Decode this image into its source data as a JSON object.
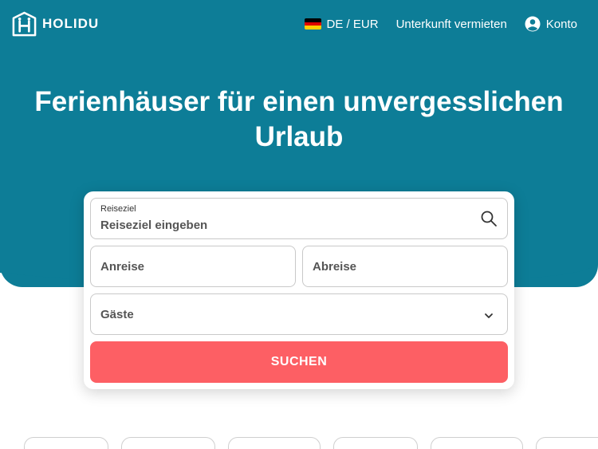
{
  "brand": {
    "name": "HOLIDU",
    "primary_color": "#0d7d97",
    "accent_color": "#fd5f64"
  },
  "header": {
    "locale_label": "DE / EUR",
    "host_link": "Unterkunft vermieten",
    "account_label": "Konto",
    "icons": [
      "holidu-logo-icon",
      "germany-flag-icon",
      "account-icon"
    ]
  },
  "hero": {
    "title": "Ferienhäuser für einen unvergesslichen Urlaub"
  },
  "search": {
    "destination_label": "Reiseziel",
    "destination_placeholder": "Reiseziel eingeben",
    "checkin_placeholder": "Anreise",
    "checkout_placeholder": "Abreise",
    "guests_placeholder": "Gäste",
    "submit_label": "SUCHEN",
    "icons": [
      "search-icon",
      "chevron-down-icon"
    ]
  },
  "categories": {
    "chip_count_visible": 6
  }
}
